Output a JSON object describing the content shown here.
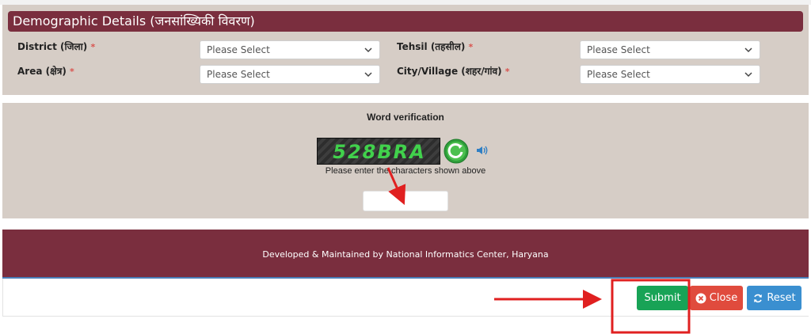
{
  "demographic": {
    "title": "Demographic Details (जनसांख्यिकी विवरण)",
    "fields": [
      {
        "label": "District (जिला)",
        "required": "*",
        "value": "Please Select"
      },
      {
        "label": "Tehsil (तहसील)",
        "required": "*",
        "value": "Please Select"
      },
      {
        "label": "Area (क्षेत्र)",
        "required": "*",
        "value": "Please Select"
      },
      {
        "label": "City/Village (शहर/गांव)",
        "required": "*",
        "value": "Please Select"
      }
    ]
  },
  "verification": {
    "title": "Word verification",
    "captcha_text": "528BRA",
    "hint": "Please enter the characters shown above",
    "input_value": ""
  },
  "footer": {
    "text": "Developed & Maintained by National Informatics Center, Haryana"
  },
  "actions": {
    "submit_label": "Submit",
    "close_label": "Close",
    "reset_label": "Reset"
  },
  "colors": {
    "header_maroon": "#7a2e3e",
    "panel_beige": "#d6cdc6",
    "submit_green": "#18a356",
    "close_red": "#e04b3d",
    "reset_blue": "#3a8fd0",
    "annotation_red": "#e02020"
  },
  "icons": {
    "captcha_refresh": "refresh-icon",
    "captcha_audio": "speaker-icon",
    "close": "times-circle-icon",
    "reset": "refresh-icon"
  }
}
